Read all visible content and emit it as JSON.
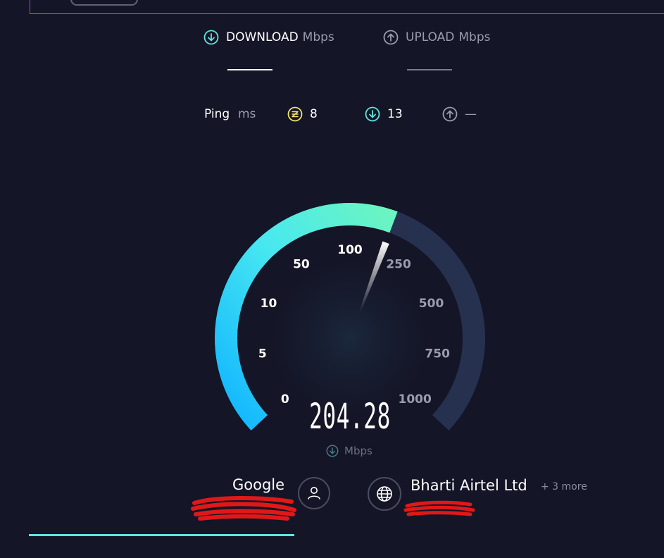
{
  "tabs": [
    {
      "label": "DOWNLOAD",
      "unit": "Mbps",
      "icon": "download-arrow-icon",
      "active": true
    },
    {
      "label": "UPLOAD",
      "unit": "Mbps",
      "icon": "upload-arrow-icon",
      "active": false
    }
  ],
  "ping": {
    "label": "Ping",
    "unit": "ms",
    "idle": {
      "value": "8",
      "icon": "idle-latency-icon"
    },
    "download": {
      "value": "13",
      "icon": "download-latency-icon"
    },
    "upload": {
      "value": "—",
      "icon": "upload-latency-icon"
    }
  },
  "gauge": {
    "ticks": [
      "0",
      "5",
      "10",
      "50",
      "100",
      "250",
      "500",
      "750",
      "1000"
    ],
    "value": "204.28",
    "unit": "Mbps",
    "fill_to_tick_fraction": 0.62,
    "colors": {
      "accent_start": "#10b4ff",
      "accent_end": "#6cf5c0",
      "track": "#263150"
    }
  },
  "server": {
    "host": "Google",
    "host_icon": "user-icon",
    "isp": "Bharti Airtel Ltd",
    "isp_more": "+ 3 more",
    "isp_icon": "globe-icon"
  },
  "progress": {
    "fraction": 0.4
  }
}
